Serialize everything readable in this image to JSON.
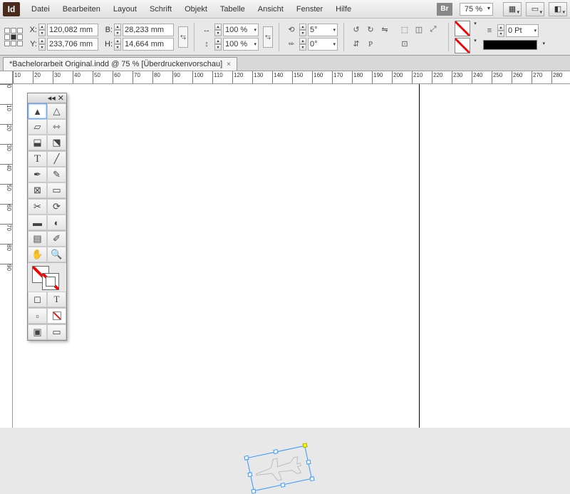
{
  "app": {
    "logo": "Id",
    "bridge": "Br"
  },
  "menu": [
    "Datei",
    "Bearbeiten",
    "Layout",
    "Schrift",
    "Objekt",
    "Tabelle",
    "Ansicht",
    "Fenster",
    "Hilfe"
  ],
  "zoom": "75 %",
  "coords": {
    "x_label": "X:",
    "y_label": "Y:",
    "w_label": "B:",
    "h_label": "H:",
    "x": "120,082 mm",
    "y": "233,706 mm",
    "w": "28,233 mm",
    "h": "14,664 mm"
  },
  "scale": {
    "sx": "100 %",
    "sy": "100 %"
  },
  "rotate": {
    "angle": "5°",
    "shear": "0°"
  },
  "stroke": {
    "weight": "0 Pt"
  },
  "tab": {
    "title": "*Bachelorarbeit Original.indd @ 75 % [Überdruckenvorschau]"
  },
  "ruler_h": [
    10,
    20,
    30,
    40,
    50,
    60,
    70,
    80,
    90,
    100,
    110,
    120,
    130,
    140,
    150,
    160,
    170,
    180,
    190,
    200,
    210,
    220,
    230,
    240,
    250,
    260,
    270,
    280
  ],
  "ruler_v": [
    0,
    10,
    20,
    30,
    40,
    50,
    60,
    70,
    80,
    90
  ]
}
